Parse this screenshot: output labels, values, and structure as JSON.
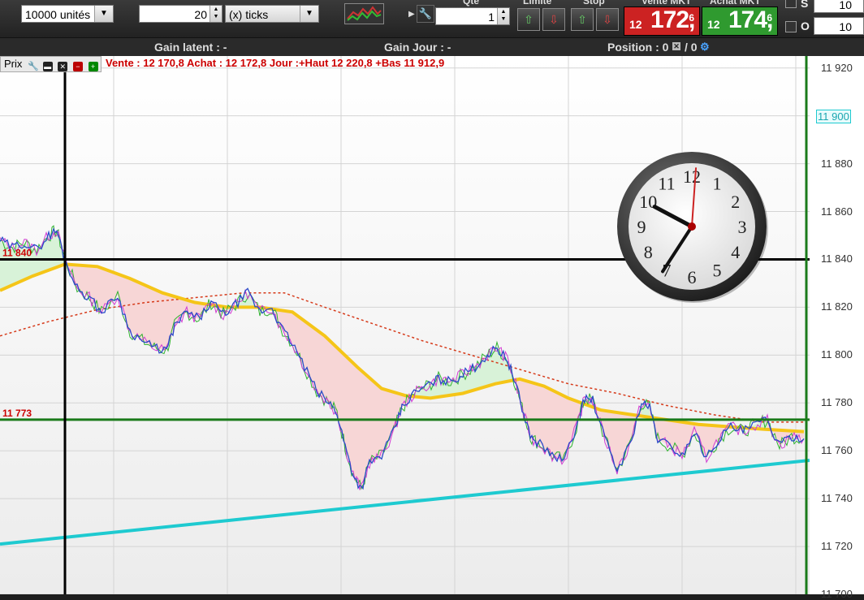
{
  "toolbar": {
    "quantity_select": "10000 unités",
    "ticks_value": "20",
    "ticks_label": "(x) ticks",
    "qty_label": "Qté",
    "qty_value": "1",
    "limit_label": "Limite",
    "stop_label": "Stop",
    "sell_label": "Vente MKT",
    "sell_prefix": "12",
    "sell_main": "172,",
    "sell_sup": "6",
    "buy_label": "Achat MKT",
    "buy_prefix": "12",
    "buy_main": "174,",
    "buy_sup": "6",
    "s_label": "S",
    "s_value": "10",
    "o_label": "O",
    "o_value": "10",
    "sell_color": "#cc2222",
    "buy_color": "#2f9a2f"
  },
  "infobar": {
    "gain_latent": "Gain latent : -",
    "gain_jour": "Gain Jour : -",
    "position": "Position : 0",
    "position_sep": "/ 0"
  },
  "panel": {
    "title": "Prix",
    "quote": "Vente : 12 170,8 Achat : 12 172,8 Jour :+Haut 12 220,8 +Bas 11 912,9"
  },
  "chart_data": {
    "type": "line",
    "y_ticks": [
      "11 920",
      "11 900",
      "11 880",
      "11 860",
      "11 840",
      "11 820",
      "11 800",
      "11 780",
      "11 760",
      "11 740",
      "11 720",
      "11 700"
    ],
    "ylim": [
      11700,
      11925
    ],
    "highlight_tick": "11 900",
    "line_tags": [
      {
        "label": "11 840",
        "value": 11840,
        "color": "#000000"
      },
      {
        "label": "11 773",
        "value": 11773,
        "color": "#1a7a1a"
      }
    ],
    "price_series": [
      [
        0,
        11848
      ],
      [
        15,
        11845
      ],
      [
        30,
        11847
      ],
      [
        45,
        11844
      ],
      [
        60,
        11850
      ],
      [
        70,
        11852
      ],
      [
        80,
        11840
      ],
      [
        95,
        11828
      ],
      [
        110,
        11824
      ],
      [
        125,
        11818
      ],
      [
        145,
        11825
      ],
      [
        160,
        11810
      ],
      [
        175,
        11806
      ],
      [
        190,
        11803
      ],
      [
        205,
        11802
      ],
      [
        215,
        11812
      ],
      [
        230,
        11818
      ],
      [
        245,
        11815
      ],
      [
        260,
        11822
      ],
      [
        275,
        11817
      ],
      [
        290,
        11821
      ],
      [
        305,
        11826
      ],
      [
        320,
        11818
      ],
      [
        335,
        11820
      ],
      [
        345,
        11812
      ],
      [
        360,
        11805
      ],
      [
        375,
        11795
      ],
      [
        390,
        11785
      ],
      [
        405,
        11780
      ],
      [
        415,
        11776
      ],
      [
        425,
        11762
      ],
      [
        435,
        11750
      ],
      [
        445,
        11744
      ],
      [
        455,
        11755
      ],
      [
        470,
        11758
      ],
      [
        485,
        11768
      ],
      [
        495,
        11778
      ],
      [
        510,
        11784
      ],
      [
        525,
        11787
      ],
      [
        540,
        11790
      ],
      [
        555,
        11789
      ],
      [
        570,
        11792
      ],
      [
        585,
        11795
      ],
      [
        600,
        11800
      ],
      [
        612,
        11803
      ],
      [
        625,
        11798
      ],
      [
        635,
        11788
      ],
      [
        645,
        11775
      ],
      [
        655,
        11765
      ],
      [
        665,
        11763
      ],
      [
        680,
        11758
      ],
      [
        695,
        11756
      ],
      [
        710,
        11770
      ],
      [
        720,
        11782
      ],
      [
        730,
        11781
      ],
      [
        745,
        11765
      ],
      [
        760,
        11752
      ],
      [
        775,
        11762
      ],
      [
        790,
        11780
      ],
      [
        800,
        11778
      ],
      [
        810,
        11765
      ],
      [
        825,
        11762
      ],
      [
        840,
        11758
      ],
      [
        855,
        11768
      ],
      [
        870,
        11757
      ],
      [
        885,
        11765
      ],
      [
        900,
        11770
      ],
      [
        915,
        11768
      ],
      [
        930,
        11771
      ],
      [
        945,
        11773
      ],
      [
        960,
        11762
      ],
      [
        975,
        11766
      ],
      [
        990,
        11765
      ]
    ],
    "ma_short": [
      [
        0,
        11827
      ],
      [
        40,
        11833
      ],
      [
        80,
        11838
      ],
      [
        120,
        11837
      ],
      [
        160,
        11832
      ],
      [
        200,
        11826
      ],
      [
        240,
        11822
      ],
      [
        280,
        11820
      ],
      [
        320,
        11820
      ],
      [
        360,
        11818
      ],
      [
        400,
        11808
      ],
      [
        440,
        11795
      ],
      [
        470,
        11786
      ],
      [
        500,
        11783
      ],
      [
        530,
        11782
      ],
      [
        570,
        11784
      ],
      [
        610,
        11788
      ],
      [
        640,
        11790
      ],
      [
        670,
        11787
      ],
      [
        700,
        11782
      ],
      [
        740,
        11777
      ],
      [
        780,
        11775
      ],
      [
        820,
        11773
      ],
      [
        860,
        11771
      ],
      [
        900,
        11770
      ],
      [
        940,
        11769
      ],
      [
        990,
        11768
      ]
    ],
    "ma_long": [
      [
        0,
        11808
      ],
      [
        60,
        11814
      ],
      [
        120,
        11819
      ],
      [
        180,
        11822
      ],
      [
        240,
        11824
      ],
      [
        300,
        11826
      ],
      [
        350,
        11826
      ],
      [
        400,
        11820
      ],
      [
        460,
        11813
      ],
      [
        520,
        11806
      ],
      [
        580,
        11800
      ],
      [
        640,
        11794
      ],
      [
        700,
        11788
      ],
      [
        760,
        11784
      ],
      [
        820,
        11779
      ],
      [
        880,
        11775
      ],
      [
        940,
        11772
      ],
      [
        990,
        11772
      ]
    ],
    "trendline": [
      [
        0,
        11721
      ],
      [
        997,
        11756
      ]
    ],
    "vline_black_x": 80,
    "vline_green_x": 993
  },
  "colors": {
    "price": "#2a4cc8",
    "ma_short": "#f5c518",
    "ma_long": "#d63a1a",
    "trend": "#1ecad0",
    "fill_up": "#d8f2d8",
    "fill_down": "#f7d6d6"
  }
}
